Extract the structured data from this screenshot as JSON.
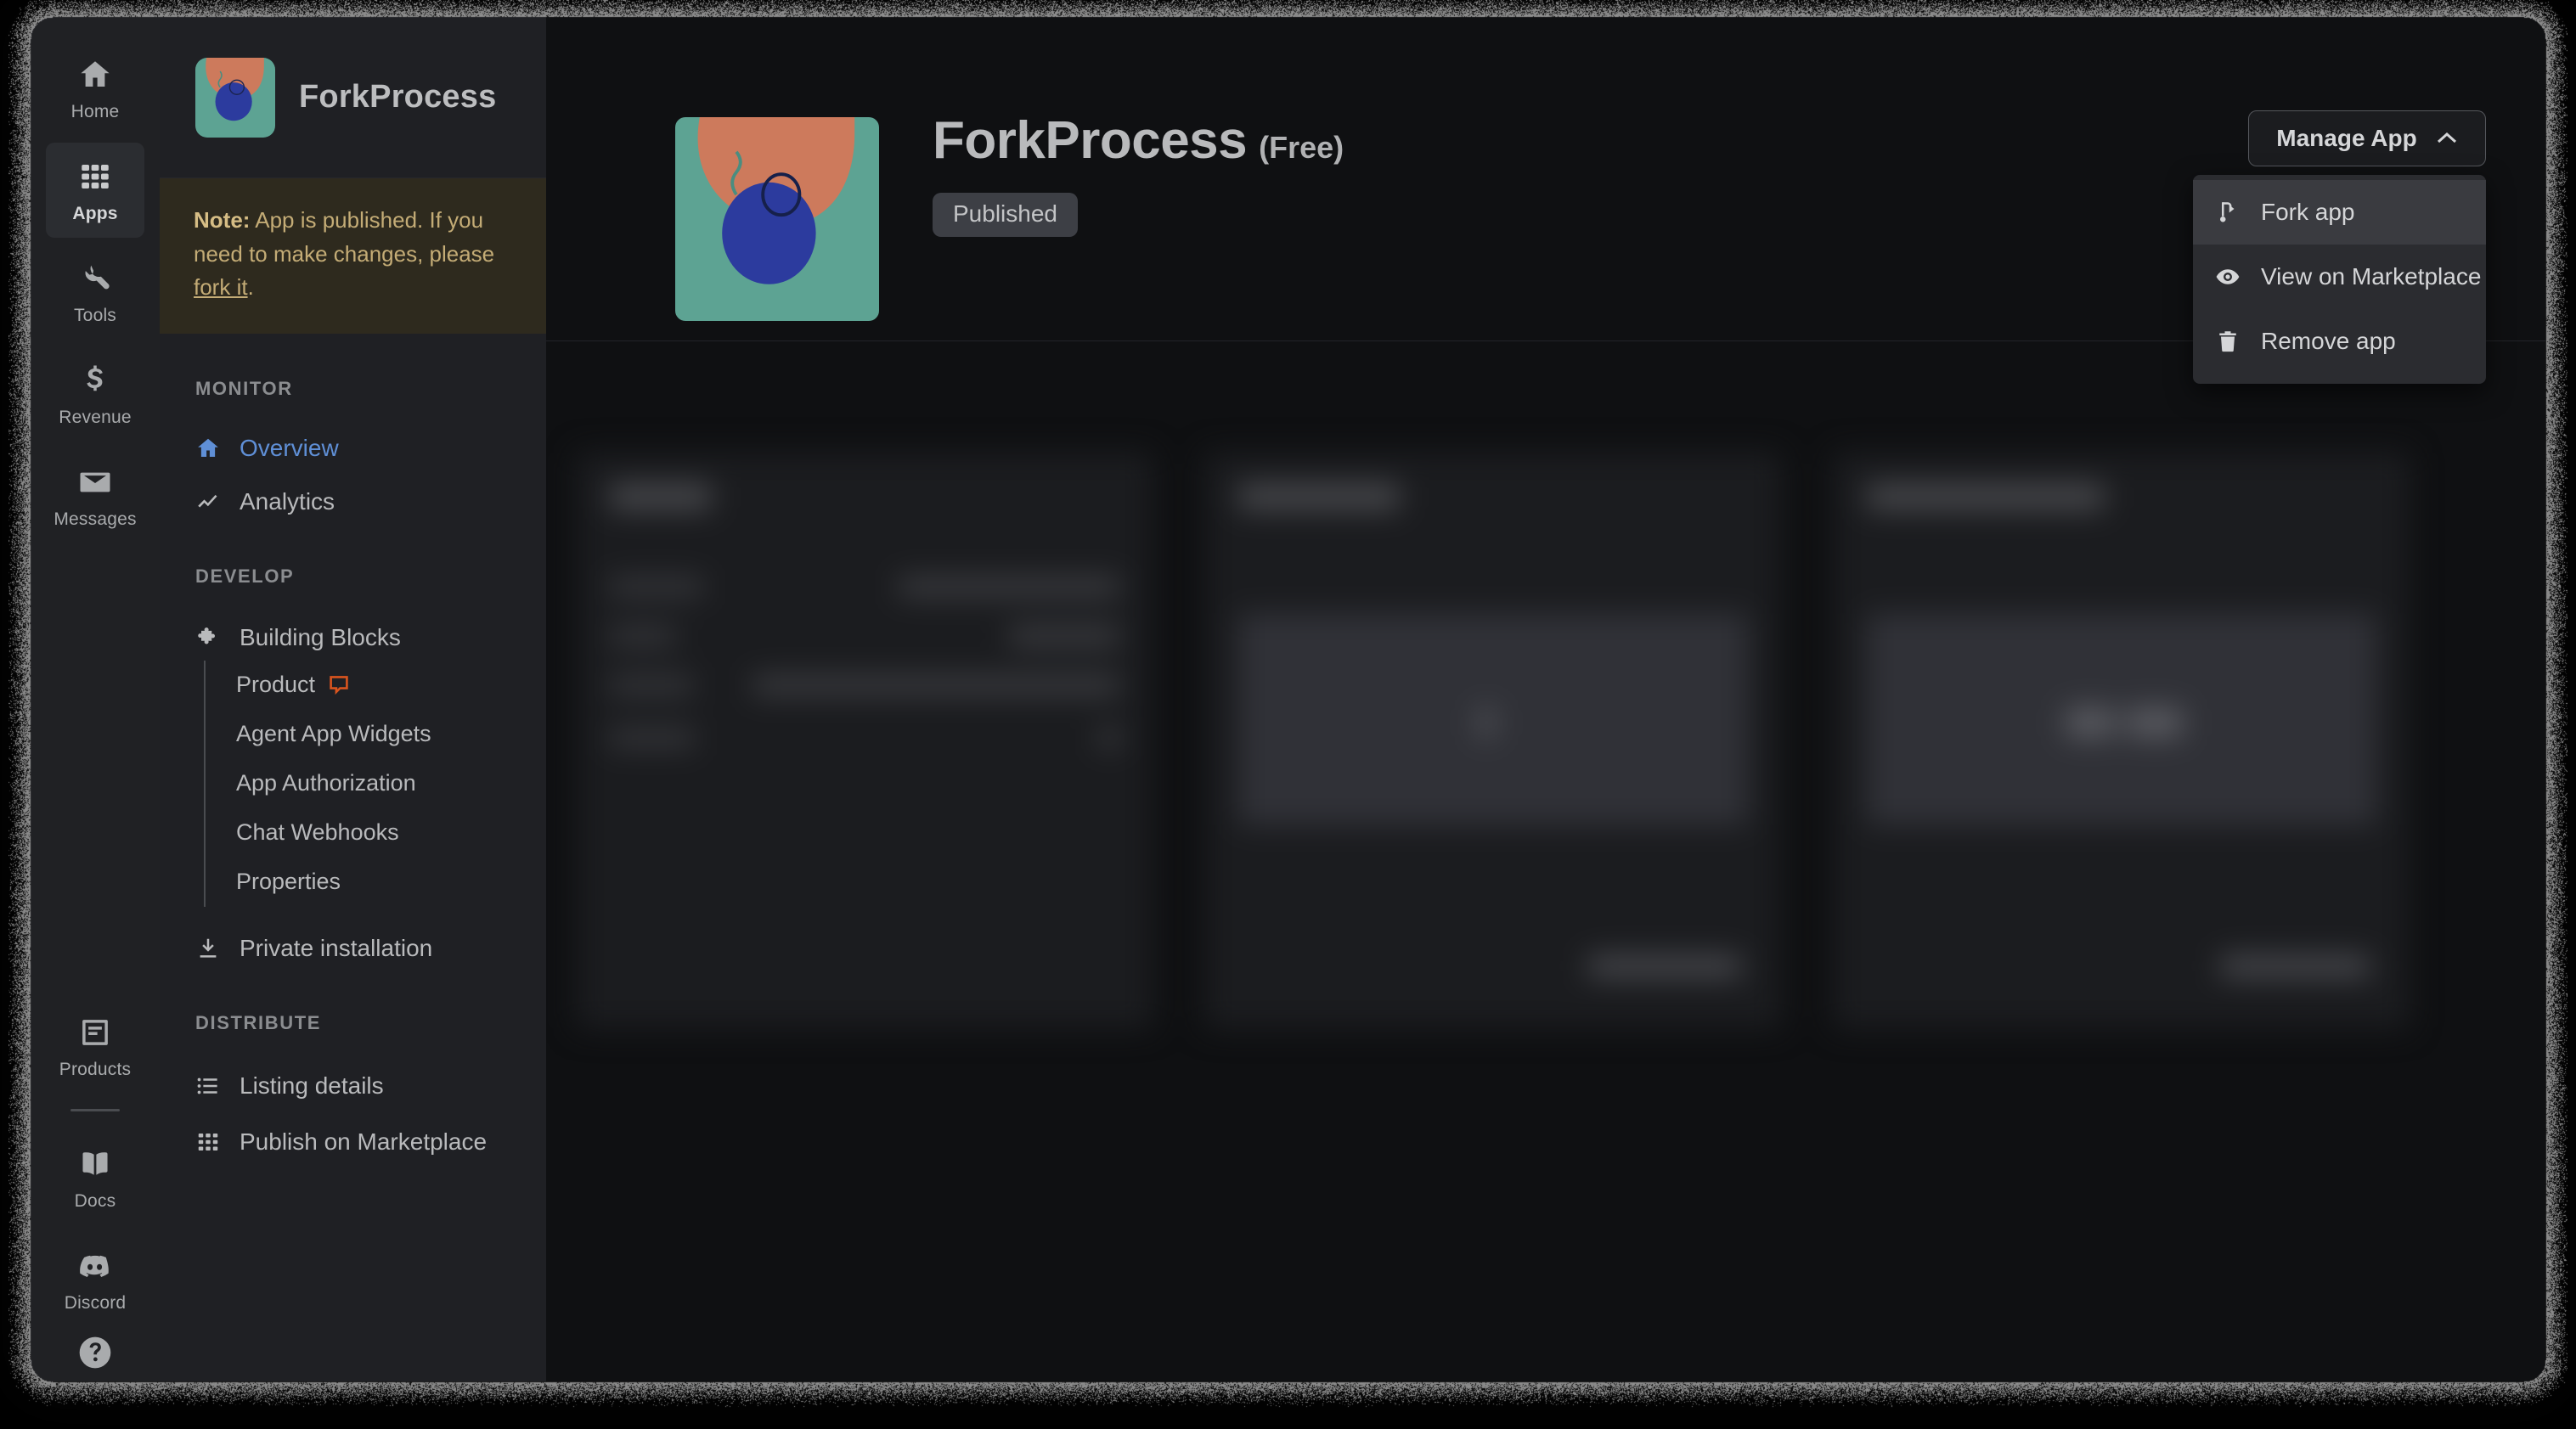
{
  "window": {
    "app_name": "ForkProcess"
  },
  "icon_rail": {
    "items": [
      {
        "label": "Home",
        "icon": "home-icon",
        "active": false
      },
      {
        "label": "Apps",
        "icon": "grid-icon",
        "active": true
      },
      {
        "label": "Tools",
        "icon": "wrench-icon",
        "active": false
      },
      {
        "label": "Revenue",
        "icon": "dollar-icon",
        "active": false
      },
      {
        "label": "Messages",
        "icon": "envelope-icon",
        "active": false
      }
    ],
    "bottom_items": [
      {
        "label": "Products",
        "icon": "document-icon"
      },
      {
        "label": "Docs",
        "icon": "book-icon"
      },
      {
        "label": "Discord",
        "icon": "discord-icon"
      }
    ],
    "help_icon": "help-icon"
  },
  "sidebar": {
    "app_name": "ForkProcess",
    "app_icon": "app-artwork-icon",
    "note": {
      "prefix_bold": "Note:",
      "text": " App is published. If you need to make changes, please ",
      "link": "fork it",
      "suffix": "."
    },
    "sections": [
      {
        "title": "MONITOR",
        "items": [
          {
            "label": "Overview",
            "icon": "home-icon",
            "active": true,
            "badge": null
          },
          {
            "label": "Analytics",
            "icon": "trend-icon",
            "active": false,
            "badge": null
          }
        ]
      },
      {
        "title": "DEVELOP",
        "items": [
          {
            "label": "Building Blocks",
            "icon": "puzzle-icon",
            "active": false,
            "badge": null
          }
        ],
        "subitems": [
          {
            "label": "Product",
            "badge": "chat-bubble-icon"
          },
          {
            "label": "Agent App Widgets",
            "badge": null
          },
          {
            "label": "App Authorization",
            "badge": null
          },
          {
            "label": "Chat Webhooks",
            "badge": null
          },
          {
            "label": "Properties",
            "badge": null
          }
        ],
        "trailing_items": [
          {
            "label": "Private installation",
            "icon": "download-icon",
            "active": false,
            "badge": null
          }
        ]
      },
      {
        "title": "DISTRIBUTE",
        "items": [
          {
            "label": "Listing details",
            "icon": "list-icon",
            "active": false,
            "badge": null
          },
          {
            "label": "Publish on Marketplace",
            "icon": "grid-icon",
            "active": false,
            "badge": null
          }
        ]
      }
    ]
  },
  "main": {
    "app_icon": "app-artwork-icon",
    "title": "ForkProcess",
    "price": "(Free)",
    "status_badge": "Published",
    "manage_button": {
      "label": "Manage App",
      "chevron": "chevron-up-icon"
    },
    "manage_menu": [
      {
        "label": "Fork app",
        "icon": "fork-icon",
        "hovered": true
      },
      {
        "label": "View on Marketplace",
        "icon": "eye-icon",
        "hovered": false
      },
      {
        "label": "Remove app",
        "icon": "trash-icon",
        "hovered": false
      }
    ]
  },
  "colors": {
    "accent_blue": "#5f8fd6",
    "note_text": "#c4ac76",
    "note_bg": "#2e2a1e",
    "badge_bg": "#3d3f45",
    "product_badge": "#d9541e",
    "icon_artwork_teal": "#5da393",
    "icon_artwork_salmon": "#cd7a5c",
    "icon_artwork_blue": "#2c3b9e"
  }
}
